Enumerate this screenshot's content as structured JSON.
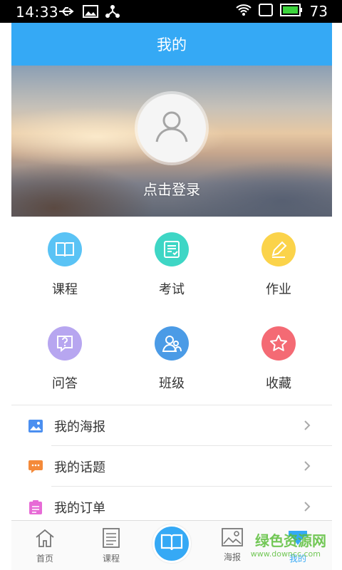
{
  "status_bar": {
    "time": "14:33",
    "battery": "73",
    "icons": [
      "usb-icon",
      "image-icon",
      "share-icon",
      "wifi-icon",
      "sim-icon",
      "battery-icon"
    ]
  },
  "header": {
    "title": "我的"
  },
  "profile": {
    "login_label": "点击登录",
    "avatar_icon": "user-icon"
  },
  "grid": [
    {
      "label": "课程",
      "icon": "book-icon",
      "color": "#5ac3f5"
    },
    {
      "label": "考试",
      "icon": "checklist-icon",
      "color": "#3ed6c5"
    },
    {
      "label": "作业",
      "icon": "pencil-icon",
      "color": "#fbd34a"
    },
    {
      "label": "问答",
      "icon": "question-icon",
      "color": "#b7a6f0"
    },
    {
      "label": "班级",
      "icon": "users-icon",
      "color": "#4b9be6"
    },
    {
      "label": "收藏",
      "icon": "star-icon",
      "color": "#f46a74"
    }
  ],
  "list": [
    {
      "label": "我的海报",
      "icon": "poster-icon",
      "color": "#4b8ff0"
    },
    {
      "label": "我的话题",
      "icon": "topic-icon",
      "color": "#f48a3a"
    },
    {
      "label": "我的订单",
      "icon": "order-icon",
      "color": "#e76bd6"
    }
  ],
  "tabbar": {
    "tabs": [
      {
        "label": "首页",
        "icon": "home-icon"
      },
      {
        "label": "课程",
        "icon": "list-icon"
      },
      {
        "label": "",
        "icon": "open-book-icon"
      },
      {
        "label": "海报",
        "icon": "picture-icon"
      },
      {
        "label": "我的",
        "icon": "profile-icon"
      }
    ],
    "active_color": "#35a9f5"
  },
  "watermark": {
    "text": "绿色资源网",
    "sub": "www.downcc.com"
  },
  "colors": {
    "primary": "#35a9f5"
  }
}
